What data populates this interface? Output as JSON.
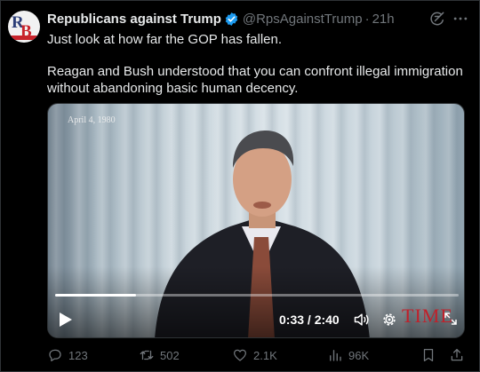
{
  "tweet": {
    "display_name": "Republicans against Trump",
    "handle": "@RpsAgainstTrump",
    "separator": "·",
    "time": "21h",
    "text_line1": "Just look at how far the GOP has fallen.",
    "text_line2": "Reagan and Bush understood that you can confront illegal immigration without abandoning basic human decency.",
    "avatar_letters": {
      "first": "R",
      "second": "B"
    }
  },
  "video": {
    "date_overlay": "April 4, 1980",
    "current_time": "0:33",
    "duration": "2:40",
    "timecode": "0:33 / 2:40",
    "progress": 0.2,
    "brand_watermark": "TIME"
  },
  "actions": {
    "replies": "123",
    "retweets": "502",
    "likes": "2.1K",
    "views": "96K"
  },
  "colors": {
    "background": "#000000",
    "text": "#e7e9ea",
    "muted": "#71767b",
    "verified": "#1d9bf0",
    "brand_red": "#c0202a"
  },
  "icons": [
    "verified-badge-icon",
    "grok-icon",
    "more-icon",
    "play-icon",
    "volume-icon",
    "settings-icon",
    "fullscreen-icon",
    "reply-icon",
    "retweet-icon",
    "like-icon",
    "views-icon",
    "bookmark-icon",
    "share-icon"
  ]
}
